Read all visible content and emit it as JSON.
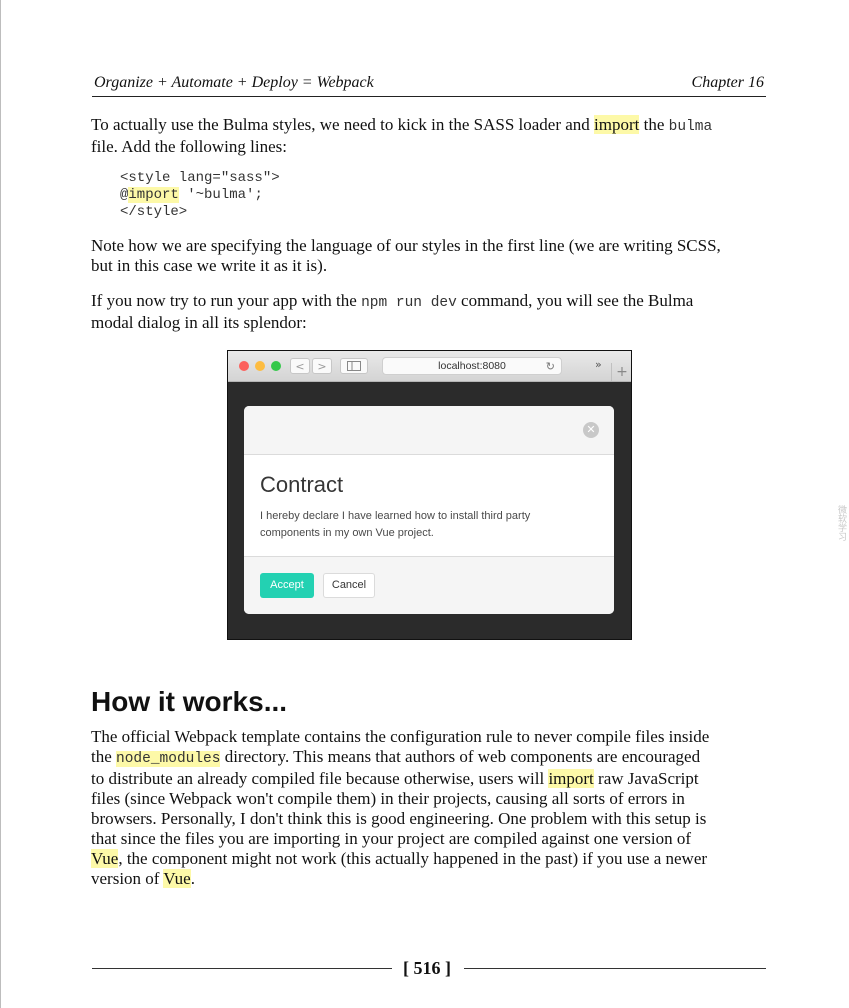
{
  "header": {
    "left": "Organize + Automate + Deploy = Webpack",
    "right": "Chapter 16"
  },
  "para1": {
    "t1": "To actually use the Bulma styles, we need to kick in the SASS loader and ",
    "hl1": "import",
    "t2": " the ",
    "code1": "bulma",
    "line2": "file. Add the following lines:"
  },
  "code": {
    "line1": "<style lang=\"sass\">",
    "line2_at": "@",
    "line2_hl": "import",
    "line2_rest": " '~bulma';",
    "line3": "</style>"
  },
  "para2": {
    "line1": "Note how we are specifying the language of our styles in the first line (we are writing SCSS,",
    "line2": "but in this case we write it as it is)."
  },
  "para3": {
    "t1": "If you now try to run your app with the ",
    "code1": "npm run dev",
    "t2": " command, you will see the Bulma",
    "line2": "modal dialog in all its splendor:"
  },
  "screenshot": {
    "url": "localhost:8080",
    "nav_back": "<",
    "nav_forward": ">",
    "more": "»",
    "plus": "+",
    "modal_title": "Contract",
    "modal_text1": "I hereby declare I have learned how to install third party",
    "modal_text2": "components in my own Vue project.",
    "accept": "Accept",
    "cancel": "Cancel",
    "colors": {
      "accept": "#23d1b2",
      "dot_red": "#fc605c",
      "dot_yellow": "#fdbc40",
      "dot_green": "#34c84a"
    }
  },
  "section_title": "How it works...",
  "para4": {
    "l1": "The official Webpack template contains the configuration rule to never compile files inside",
    "l2a": "the ",
    "l2code": "node_modules",
    "l2b": " directory. This means that authors of web components are encouraged",
    "l3a": "to distribute an already compiled file because otherwise, users will ",
    "l3hl": "import",
    "l3b": " raw JavaScript",
    "l4": "files (since Webpack won't compile them) in their projects, causing all sorts of errors in",
    "l5": "browsers. Personally, I don't think this is good engineering. One problem with this setup is",
    "l6": "that since the files you are importing in your project are compiled against one version of",
    "l7hl": "Vue",
    "l7b": ", the component might not work (this actually happened in the past) if you use a newer",
    "l8a": "version of ",
    "l8hl": "Vue",
    "l8b": "."
  },
  "page_number": "[ 516 ]",
  "side_mark": "微软学习"
}
